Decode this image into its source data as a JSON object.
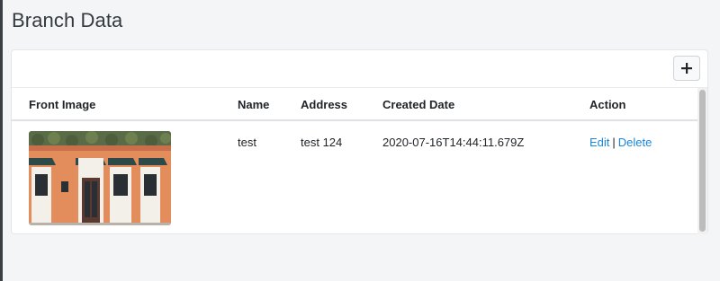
{
  "page": {
    "title": "Branch Data"
  },
  "toolbar": {
    "add_icon": "plus-icon"
  },
  "table": {
    "columns": [
      "Front Image",
      "Name",
      "Address",
      "Created Date",
      "Action"
    ],
    "rows": [
      {
        "image": "storefront-photo",
        "name": "test",
        "address": "test 124",
        "created_date": "2020-07-16T14:44:11.679Z",
        "actions": {
          "edit": "Edit",
          "separator": "|",
          "delete": "Delete"
        }
      }
    ]
  },
  "colors": {
    "link": "#1a86d9",
    "storefront": "#e08a5a"
  }
}
